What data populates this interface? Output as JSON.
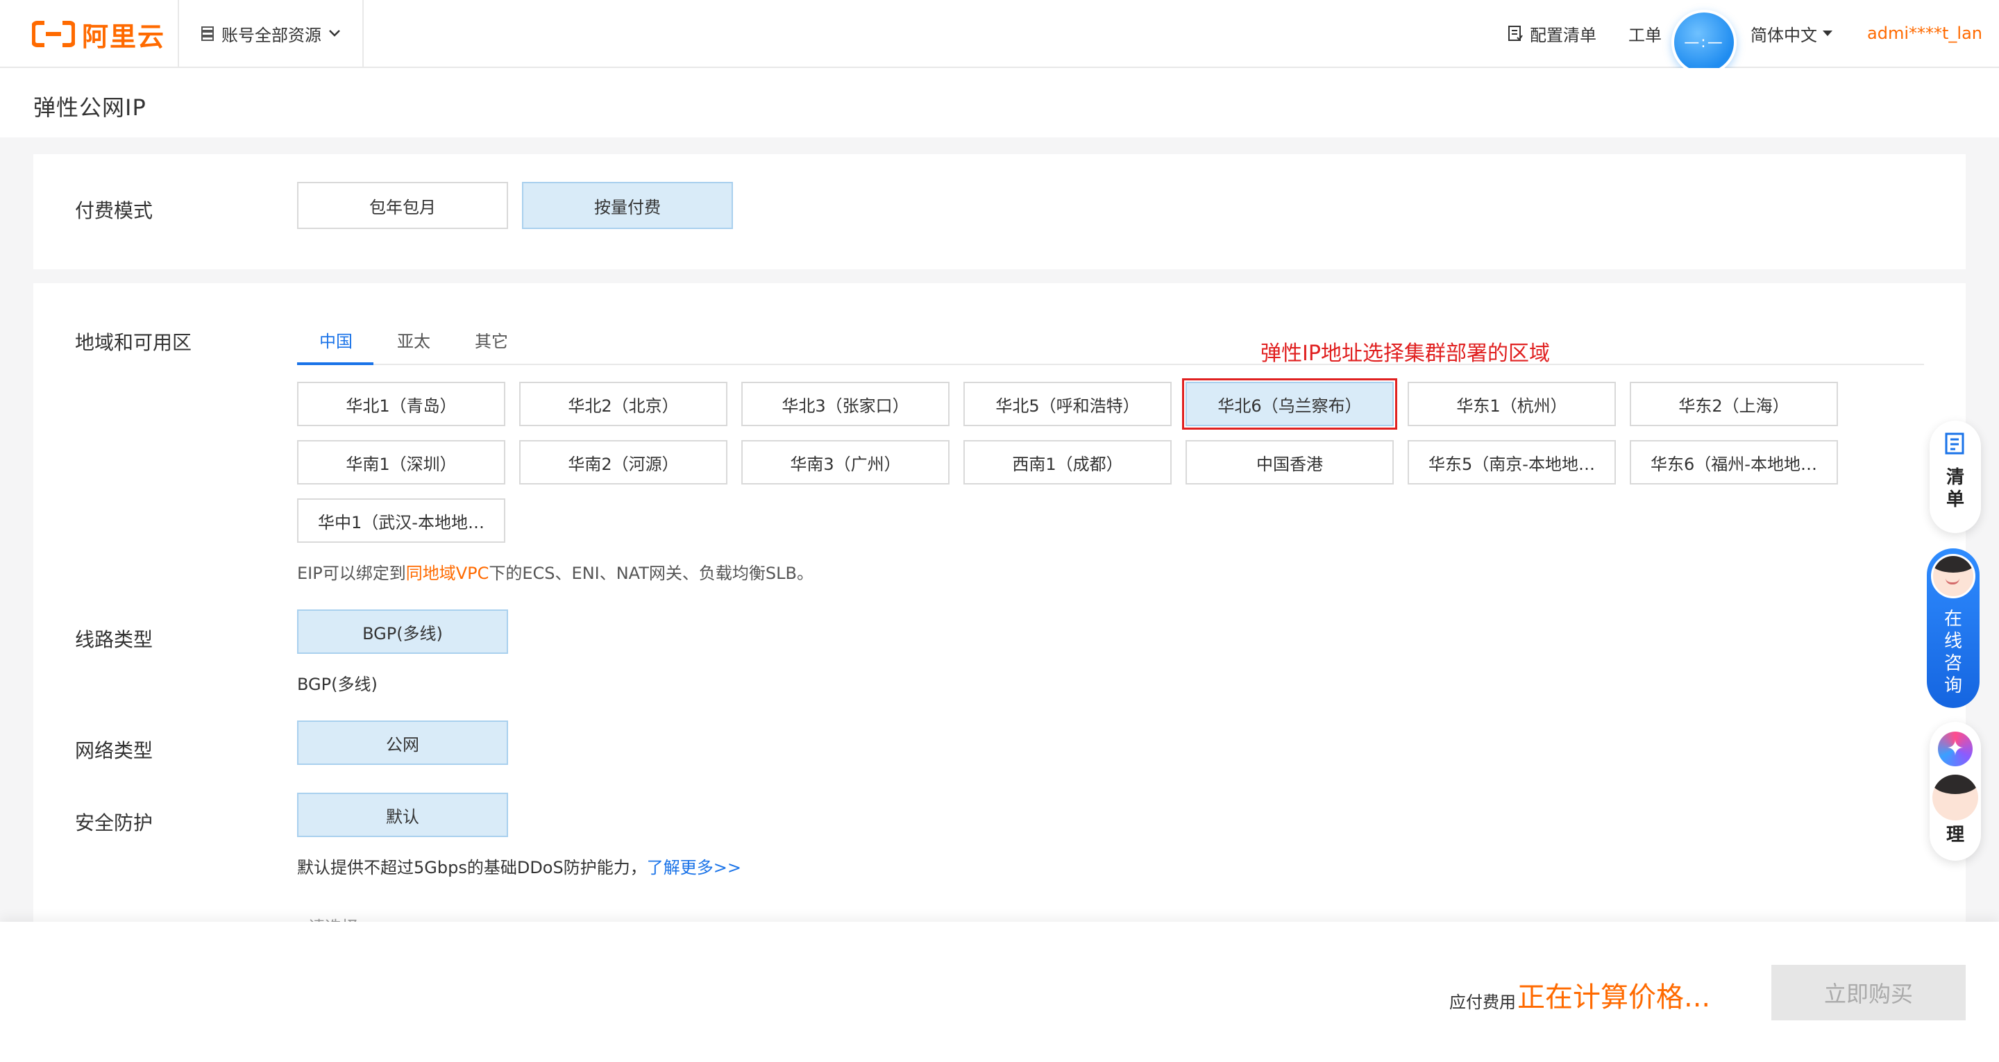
{
  "header": {
    "logo_text": "阿里云",
    "resource_switch": "账号全部资源",
    "config_list": "配置清单",
    "ticket": "工单",
    "avatar_text": "—:—",
    "language": "简体中文",
    "user": "admi****t_lan"
  },
  "page": {
    "title": "弹性公网IP"
  },
  "billing": {
    "label": "付费模式",
    "options": [
      "包年包月",
      "按量付费"
    ],
    "selected": "按量付费"
  },
  "region": {
    "label": "地域和可用区",
    "tabs": [
      "中国",
      "亚太",
      "其它"
    ],
    "active_tab": "中国",
    "annotation": "弹性IP地址选择集群部署的区域",
    "zones": [
      "华北1（青岛）",
      "华北2（北京）",
      "华北3（张家口）",
      "华北5（呼和浩特）",
      "华北6（乌兰察布）",
      "华东1（杭州）",
      "华东2（上海）",
      "华南1（深圳）",
      "华南2（河源）",
      "华南3（广州）",
      "西南1（成都）",
      "中国香港",
      "华东5（南京-本地地…",
      "华东6（福州-本地地…",
      "华中1（武汉-本地地…"
    ],
    "selected_zone": "华北6（乌兰察布）",
    "note_prefix": "EIP可以绑定到",
    "note_highlight": "同地域VPC",
    "note_suffix": "下的ECS、ENI、NAT网关、负载均衡SLB。"
  },
  "line_type": {
    "label": "线路类型",
    "option": "BGP(多线)",
    "desc": "BGP(多线)"
  },
  "network_type": {
    "label": "网络类型",
    "option": "公网"
  },
  "security": {
    "label": "安全防护",
    "option": "默认",
    "note": "默认提供不超过5Gbps的基础DDoS防护能力，",
    "link": "了解更多>>"
  },
  "cutoff_placeholder": "请选择",
  "footer": {
    "fee_label": "应付费用",
    "fee_value": "正在计算价格...",
    "buy_button": "立即购买"
  },
  "floating": {
    "list_label": "清单",
    "consult_label": "在线咨询",
    "assistant_label": "理"
  },
  "colors": {
    "brand": "#ff6a00",
    "accent": "#1a73e8",
    "selected_bg": "#d9ebf8",
    "annotation": "#e02020"
  }
}
